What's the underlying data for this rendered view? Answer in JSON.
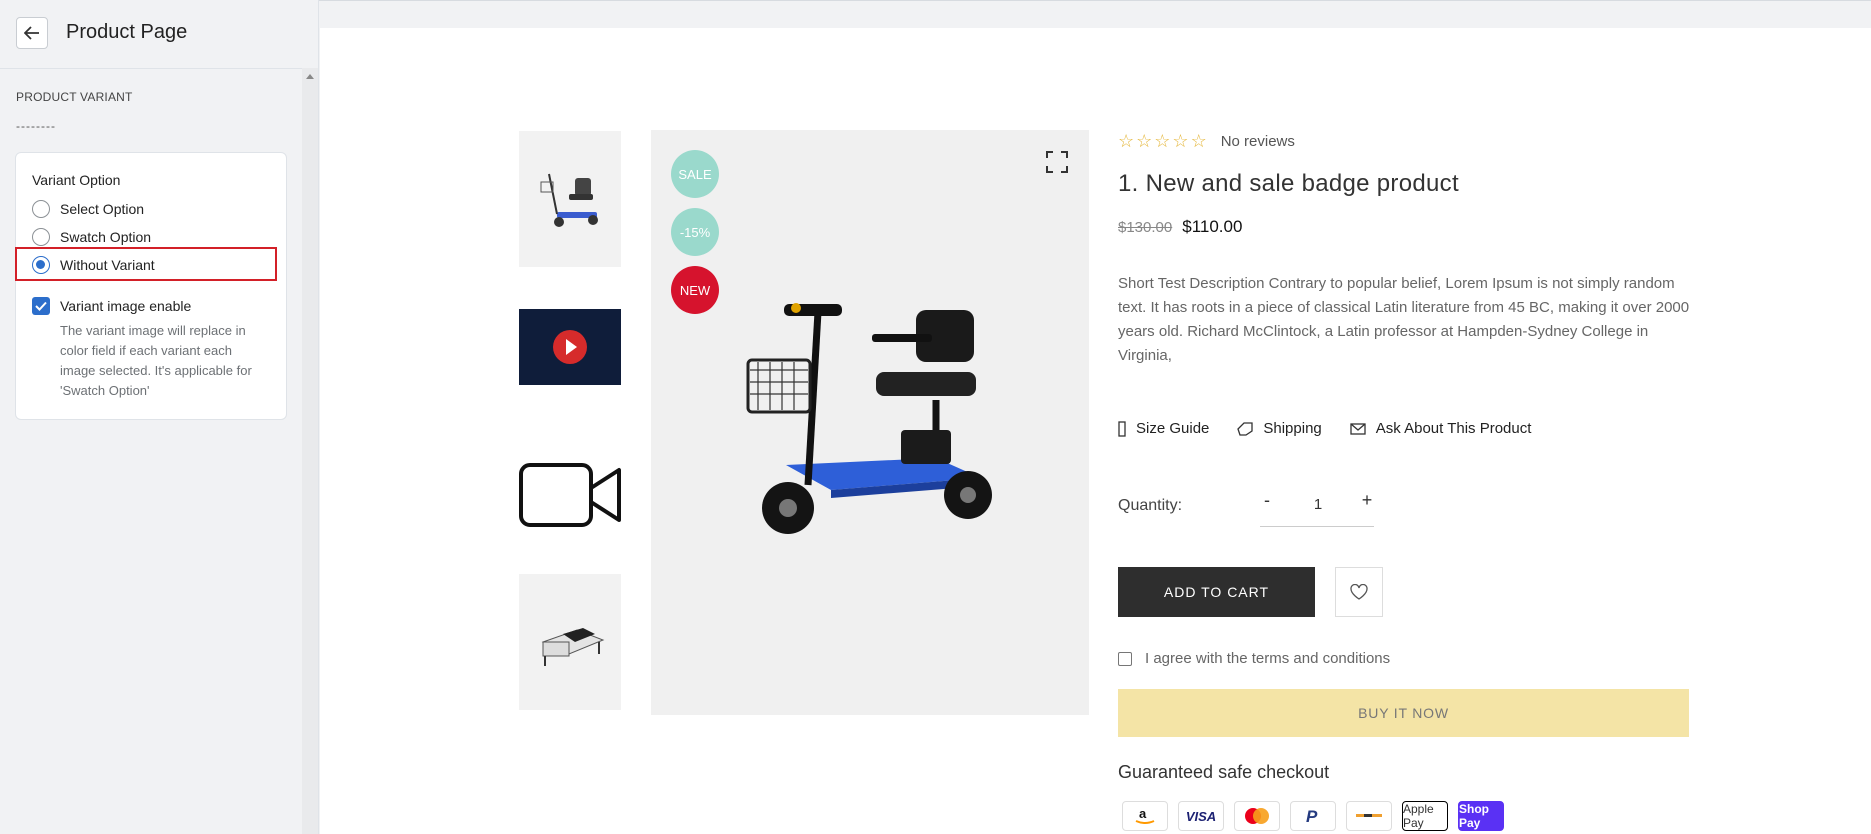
{
  "panel": {
    "title": "Product Page",
    "section_heading": "PRODUCT VARIANT",
    "section_dashes": "--------",
    "variant_option_label": "Variant Option",
    "options": [
      {
        "label": "Select Option",
        "selected": false
      },
      {
        "label": "Swatch Option",
        "selected": false
      },
      {
        "label": "Without Variant",
        "selected": true
      }
    ],
    "variant_image_label": "Variant image enable",
    "variant_image_checked": true,
    "variant_image_help": "The variant image will replace in color field if each variant each image selected. It's applicable for 'Swatch Option'"
  },
  "product": {
    "badges": [
      {
        "label": "SALE",
        "color": "#9ad9cc"
      },
      {
        "label": "-15%",
        "color": "#9ad9cc"
      },
      {
        "label": "NEW",
        "color": "#d6132d"
      }
    ],
    "rating_stars": 5,
    "reviews": "No reviews",
    "title": "1. New and sale badge product",
    "old_price": "$130.00",
    "price": "$110.00",
    "description": "Short Test Description Contrary to popular belief, Lorem Ipsum is not simply random text. It has roots in a piece of classical Latin literature from 45 BC, making it over 2000 years old. Richard McClintock, a Latin professor at Hampden-Sydney College in Virginia,",
    "links": [
      "Size Guide",
      "Shipping",
      "Ask About This Product"
    ],
    "quantity_label": "Quantity:",
    "quantity_minus": "-",
    "quantity": "1",
    "quantity_plus": "+",
    "add_to_cart": "ADD TO CART",
    "terms": "I agree with the terms and conditions",
    "buy_now": "BUY IT NOW",
    "safe_checkout": "Guaranteed safe checkout",
    "payments": [
      "amazon",
      "VISA",
      "mastercard",
      "PayPal",
      "generic-card",
      "Apple Pay",
      "Shop Pay"
    ]
  },
  "colors": {
    "accent": "#2c6ecb",
    "highlight": "#d32028",
    "cart_button": "#2e2e2e",
    "buy_now": "#f4e4a6",
    "star": "#e5b73b"
  }
}
